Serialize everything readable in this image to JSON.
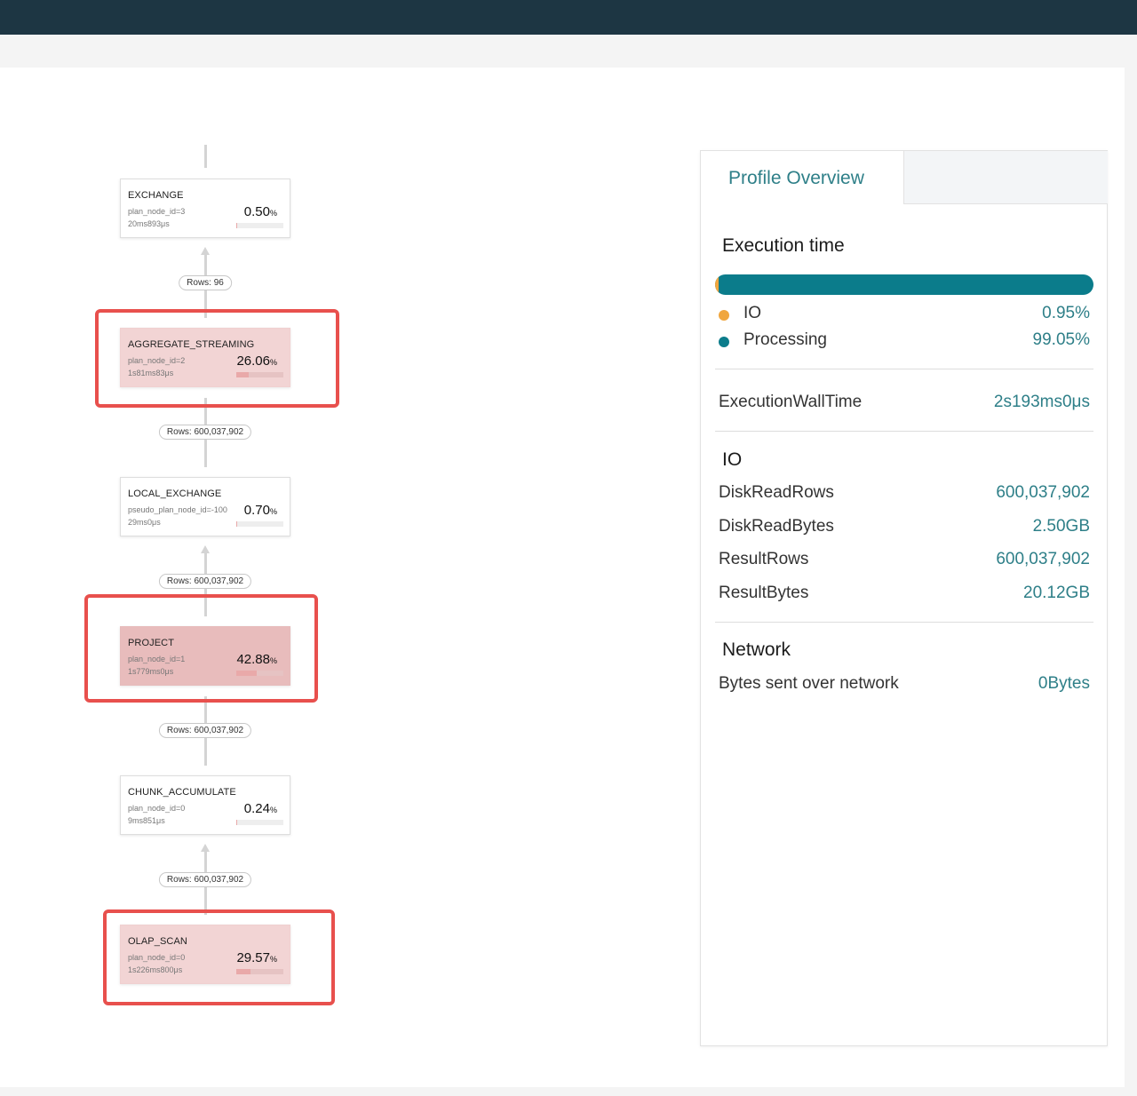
{
  "colors": {
    "topbar": "#1d3643",
    "accent": "#2e7f88",
    "io": "#f0a63e",
    "processing": "#0b7c8b",
    "highlight": "#e8504d"
  },
  "plan": {
    "edges": [
      {
        "rows_label": "Rows: 96"
      },
      {
        "rows_label": "Rows: 600,037,902"
      },
      {
        "rows_label": "Rows: 600,037,902"
      },
      {
        "rows_label": "Rows: 600,037,902"
      },
      {
        "rows_label": "Rows: 600,037,902"
      }
    ],
    "nodes": [
      {
        "name": "EXCHANGE",
        "id_label": "plan_node_id=3",
        "time": "20ms893μs",
        "pct": "0.50",
        "unit": "%",
        "fraction": 0.005
      },
      {
        "name": "AGGREGATE_STREAMING",
        "id_label": "plan_node_id=2",
        "time": "1s81ms83μs",
        "pct": "26.06",
        "unit": "%",
        "fraction": 0.2606
      },
      {
        "name": "LOCAL_EXCHANGE",
        "id_label": "pseudo_plan_node_id=-100",
        "time": "29ms0μs",
        "pct": "0.70",
        "unit": "%",
        "fraction": 0.007
      },
      {
        "name": "PROJECT",
        "id_label": "plan_node_id=1",
        "time": "1s779ms0μs",
        "pct": "42.88",
        "unit": "%",
        "fraction": 0.4288
      },
      {
        "name": "CHUNK_ACCUMULATE",
        "id_label": "plan_node_id=0",
        "time": "9ms851μs",
        "pct": "0.24",
        "unit": "%",
        "fraction": 0.0024
      },
      {
        "name": "OLAP_SCAN",
        "id_label": "plan_node_id=0",
        "time": "1s226ms800μs",
        "pct": "29.57",
        "unit": "%",
        "fraction": 0.2957
      }
    ]
  },
  "panel": {
    "tab_label": "Profile Overview",
    "execution": {
      "title": "Execution time",
      "io_fraction": 0.0095,
      "legend": [
        {
          "label": "IO",
          "value": "0.95%"
        },
        {
          "label": "Processing",
          "value": "99.05%"
        }
      ],
      "wall_time_label": "ExecutionWallTime",
      "wall_time_value": "2s193ms0μs"
    },
    "io": {
      "title": "IO",
      "rows": [
        {
          "label": "DiskReadRows",
          "value": "600,037,902"
        },
        {
          "label": "DiskReadBytes",
          "value": "2.50GB"
        },
        {
          "label": "ResultRows",
          "value": "600,037,902"
        },
        {
          "label": "ResultBytes",
          "value": "20.12GB"
        }
      ]
    },
    "network": {
      "title": "Network",
      "rows": [
        {
          "label": "Bytes sent over network",
          "value": "0Bytes"
        }
      ]
    }
  }
}
